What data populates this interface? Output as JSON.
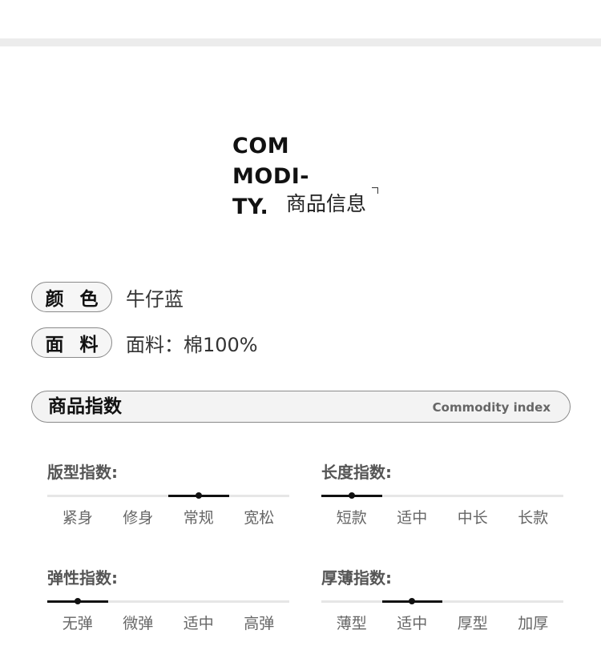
{
  "heading": {
    "en_line1": "COM",
    "en_line2": "MODI-",
    "en_line3": "TY.",
    "cn": "商品信息"
  },
  "attributes": [
    {
      "label": "颜 色",
      "value": "牛仔蓝"
    },
    {
      "label": "面 料",
      "value": "面料：棉100%"
    }
  ],
  "index_bar": {
    "title": "商品指数",
    "subtitle": "Commodity index"
  },
  "metrics": [
    {
      "title": "版型指数:",
      "options": [
        "紧身",
        "修身",
        "常规",
        "宽松"
      ],
      "selected_index": 2
    },
    {
      "title": "长度指数:",
      "options": [
        "短款",
        "适中",
        "中长",
        "长款"
      ],
      "selected_index": 0
    },
    {
      "title": "弹性指数:",
      "options": [
        "无弹",
        "微弹",
        "适中",
        "高弹"
      ],
      "selected_index": 0
    },
    {
      "title": "厚薄指数:",
      "options": [
        "薄型",
        "适中",
        "厚型",
        "加厚"
      ],
      "selected_index": 1
    }
  ]
}
